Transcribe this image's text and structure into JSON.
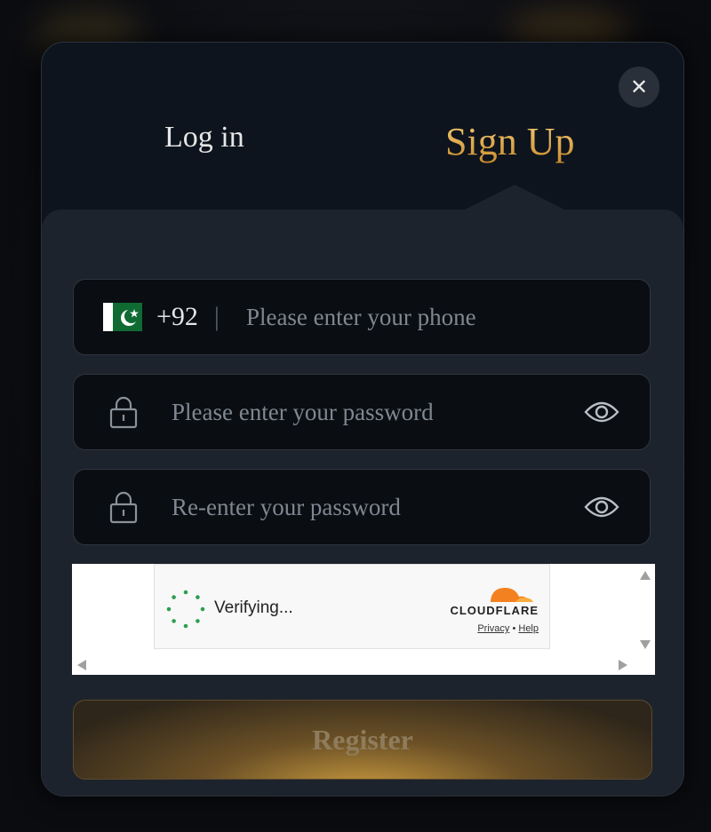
{
  "modal": {
    "tabs": {
      "login": "Log in",
      "signup": "Sign Up"
    },
    "close_icon": "close-icon"
  },
  "phone": {
    "country_flag": "pakistan-flag-icon",
    "country_code": "+92",
    "separator": "|",
    "placeholder": "Please enter your phone"
  },
  "password": {
    "placeholder": "Please enter your password",
    "lock_icon": "lock-icon",
    "eye_icon": "eye-icon"
  },
  "confirm_password": {
    "placeholder": "Re-enter your password",
    "lock_icon": "lock-icon",
    "eye_icon": "eye-icon"
  },
  "captcha": {
    "status": "Verifying...",
    "brand": "CLOUDFLARE",
    "privacy": "Privacy",
    "dot": "•",
    "help": "Help"
  },
  "register_label": "Register",
  "colors": {
    "accent_gold": "#e0a54a",
    "modal_bg": "#0e141d",
    "panel_bg": "#1d232c",
    "field_bg": "#0a0d12"
  }
}
